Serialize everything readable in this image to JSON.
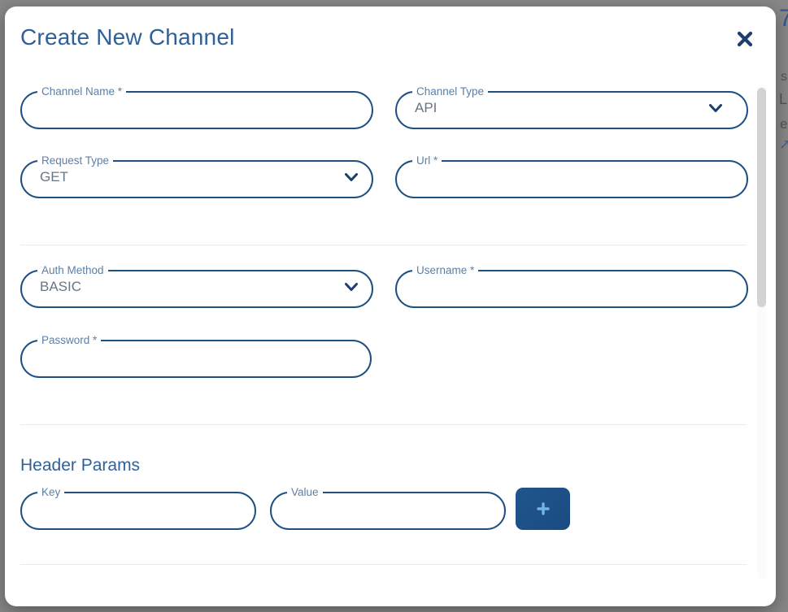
{
  "dialog": {
    "title": "Create New Channel",
    "close_icon": "close-icon"
  },
  "form": {
    "channel_name": {
      "label": "Channel Name *",
      "value": "",
      "placeholder": ""
    },
    "channel_type": {
      "label": "Channel Type",
      "value": "API",
      "icon": "chevron-down-icon"
    },
    "request_type": {
      "label": "Request Type",
      "value": "GET",
      "icon": "chevron-down-icon"
    },
    "url": {
      "label": "Url *",
      "value": "",
      "placeholder": ""
    },
    "auth_method": {
      "label": "Auth Method",
      "value": "BASIC",
      "icon": "chevron-down-icon"
    },
    "username": {
      "label": "Username *",
      "value": "",
      "placeholder": ""
    },
    "password": {
      "label": "Password *",
      "value": "",
      "placeholder": ""
    }
  },
  "header_params": {
    "title": "Header Params",
    "key": {
      "label": "Key",
      "value": "",
      "placeholder": ""
    },
    "value": {
      "label": "Value",
      "value": "",
      "placeholder": ""
    },
    "add_button": {
      "icon": "plus-icon",
      "label": "+"
    }
  },
  "colors": {
    "title_blue": "#2f6099",
    "field_border": "#1d4f82",
    "label_blue": "#5b7fa6",
    "value_gray": "#6a7583",
    "accent_button": "#1f568e",
    "plus_icon": "#6fb3e8",
    "close_icon": "#1c3f6e",
    "divider": "#e9eaec",
    "backdrop": "#878787",
    "scrollbar_thumb": "#d3d3d3"
  },
  "background": {
    "glyphs": [
      "7",
      "s",
      "L",
      "e",
      "↗"
    ]
  }
}
